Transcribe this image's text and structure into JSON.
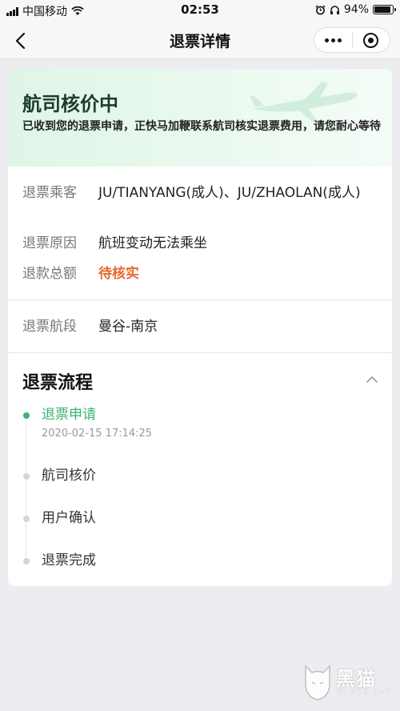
{
  "status_bar": {
    "carrier": "中国移动",
    "time": "02:53",
    "battery": "94%"
  },
  "nav": {
    "title": "退票详情"
  },
  "banner": {
    "title": "航司核价中",
    "description": "已收到您的退票申请，正快马加鞭联系航司核实退票费用，请您耐心等待"
  },
  "info": {
    "passengers_label": "退票乘客",
    "passengers_value": "JU/TIANYANG(成人)、JU/ZHAOLAN(成人)",
    "reason_label": "退票原因",
    "reason_value": "航班变动无法乘坐",
    "amount_label": "退款总额",
    "amount_value": "待核实",
    "segment_label": "退票航段",
    "segment_value": "曼谷-南京"
  },
  "process": {
    "title": "退票流程",
    "steps": [
      {
        "label": "退票申请",
        "time": "2020-02-15 17:14:25",
        "active": true
      },
      {
        "label": "航司核价",
        "active": false
      },
      {
        "label": "用户确认",
        "active": false
      },
      {
        "label": "退票完成",
        "active": false
      }
    ]
  },
  "watermark": {
    "text": "黑猫",
    "sub": "BLACK CAT"
  },
  "colors": {
    "active_green": "#3cb371",
    "pending_orange": "#e8682e",
    "banner_bg": "#dff5e7"
  }
}
